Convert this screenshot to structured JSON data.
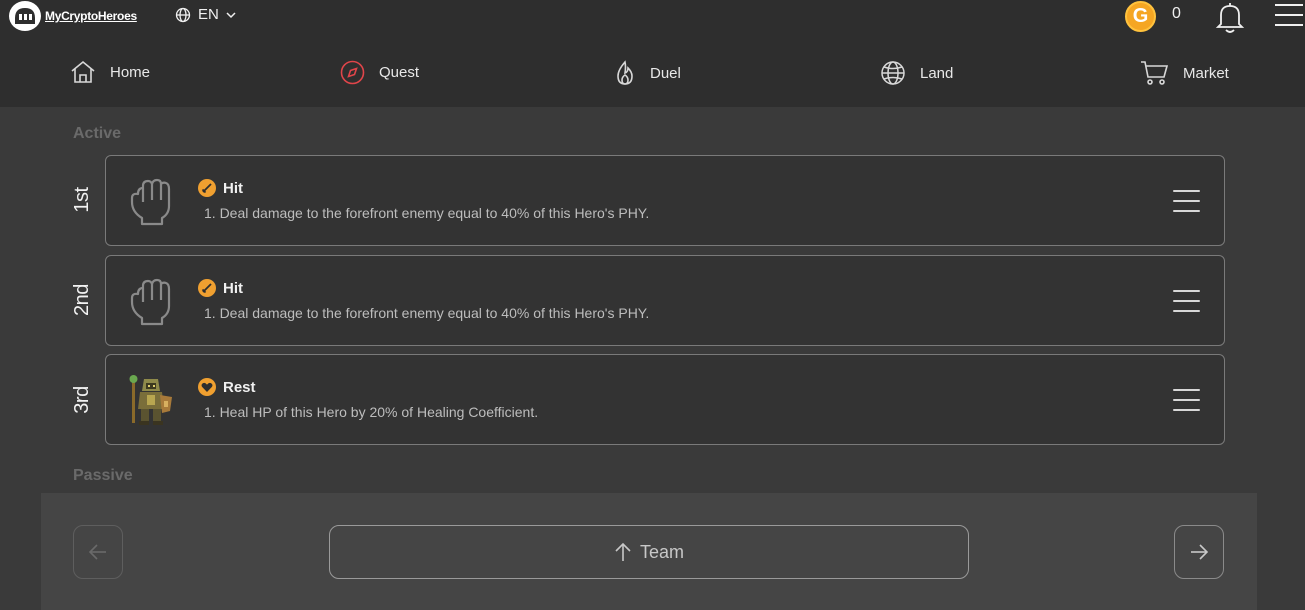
{
  "header": {
    "logo_text": "MyCryptoHeroes",
    "language": "EN",
    "coin_symbol": "G",
    "coin_count": "0"
  },
  "nav": {
    "items": [
      {
        "label": "Home",
        "icon": "home-icon"
      },
      {
        "label": "Quest",
        "icon": "compass-icon",
        "accent": "#e0454a"
      },
      {
        "label": "Duel",
        "icon": "flame-icon"
      },
      {
        "label": "Land",
        "icon": "globe-icon"
      },
      {
        "label": "Market",
        "icon": "cart-icon"
      }
    ]
  },
  "active": {
    "label": "Active",
    "skills": [
      {
        "rank": "1st",
        "name": "Hit",
        "description": "1. Deal damage to the forefront enemy equal to 40% of this Hero's PHY.",
        "icon": "fist-icon",
        "badge": "sword-icon"
      },
      {
        "rank": "2nd",
        "name": "Hit",
        "description": "1. Deal damage to the forefront enemy equal to 40% of this Hero's PHY.",
        "icon": "fist-icon",
        "badge": "sword-icon"
      },
      {
        "rank": "3rd",
        "name": "Rest",
        "description": "1. Heal HP of this Hero by 20% of Healing Coefficient.",
        "icon": "hero-sprite",
        "badge": "heart-icon"
      }
    ]
  },
  "passive": {
    "label": "Passive"
  },
  "footer": {
    "team_label": "Team"
  },
  "colors": {
    "accent_orange": "#f0a030",
    "coin": "#f5a623",
    "background": "#3a3a3a"
  }
}
